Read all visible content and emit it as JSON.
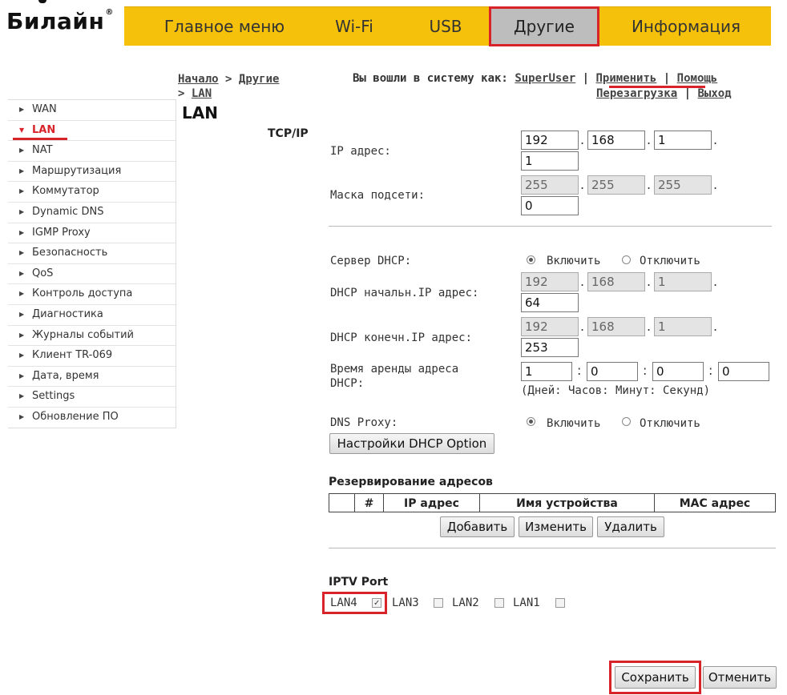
{
  "brand": {
    "name": "Билайн",
    "mark": "®"
  },
  "nav": {
    "tabs": [
      "Главное меню",
      "Wi-Fi",
      "USB",
      "Другие",
      "Информация"
    ]
  },
  "breadcrumb": {
    "home": "Начало",
    "sep": ">",
    "section": "Другие",
    "page": "LAN"
  },
  "header": {
    "logged_in_prefix": "Вы вошли в систему как:",
    "user": "SuperUser",
    "sep": "|",
    "apply": "Применить",
    "help": "Помощь",
    "reboot": "Перезагрузка",
    "logout": "Выход"
  },
  "page_title": "LAN",
  "sidebar": {
    "items": [
      "WAN",
      "LAN",
      "NAT",
      "Маршрутизация",
      "Коммутатор",
      "Dynamic DNS",
      "IGMP Proxy",
      "Безопасность",
      "QoS",
      "Контроль доступа",
      "Диагностика",
      "Журналы событий",
      "Клиент TR-069",
      "Дата, время",
      "Settings",
      "Обновление ПО"
    ]
  },
  "tcpip": {
    "title": "TCP/IP",
    "ip_label": "IP адрес:",
    "ip": [
      "192",
      "168",
      "1",
      "1"
    ],
    "mask_label": "Маска подсети:",
    "mask": [
      "255",
      "255",
      "255",
      "0"
    ]
  },
  "dhcp": {
    "server_label": "Сервер DHCP:",
    "enable": "Включить",
    "disable": "Отключить",
    "start_label": "DHCP начальн.IP адрес:",
    "start": [
      "192",
      "168",
      "1",
      "64"
    ],
    "end_label": "DHCP конечн.IP адрес:",
    "end": [
      "192",
      "168",
      "1",
      "253"
    ],
    "lease_label_1": "Время аренды адреса",
    "lease_label_2": "DHCP:",
    "lease": [
      "1",
      "0",
      "0",
      "0"
    ],
    "lease_sep": ":",
    "lease_hint": "(Дней: Часов: Минут: Секунд)",
    "dns_proxy_label": "DNS Proxy:",
    "option_button": "Настройки DHCP Option"
  },
  "reservation": {
    "title": "Резервирование адресов",
    "columns": [
      "#",
      "IP адрес",
      "Имя устройства",
      "MAC адрес"
    ],
    "add": "Добавить",
    "edit": "Изменить",
    "delete": "Удалить"
  },
  "iptv": {
    "title": "IPTV Port",
    "ports": [
      "LAN4",
      "LAN3",
      "LAN2",
      "LAN1"
    ],
    "checked": [
      true,
      false,
      false,
      false
    ]
  },
  "footer": {
    "save": "Сохранить",
    "cancel": "Отменить"
  },
  "colors": {
    "brand_yellow": "#f5c10a",
    "highlight_red": "#d9232b",
    "active_tab": "#bdbdbd"
  }
}
